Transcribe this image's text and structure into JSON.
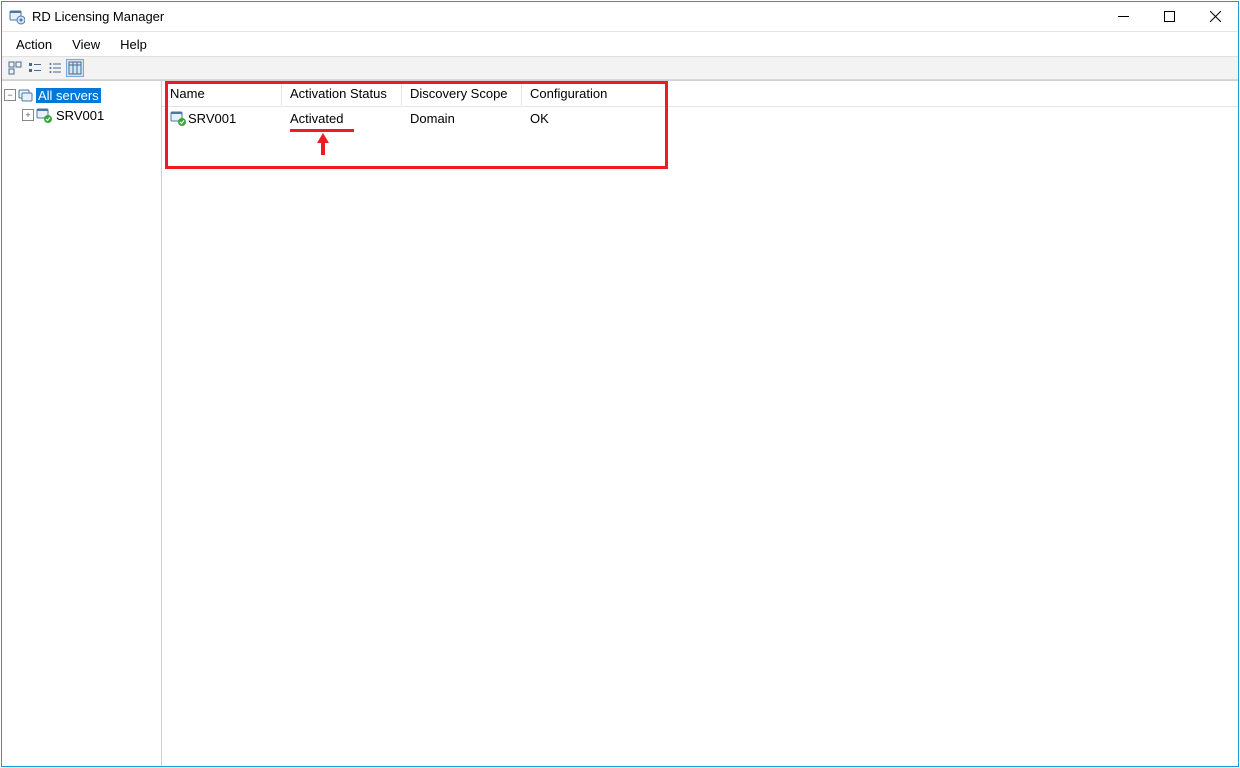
{
  "titlebar": {
    "title": "RD Licensing Manager"
  },
  "menubar": {
    "action": "Action",
    "view": "View",
    "help": "Help"
  },
  "tree": {
    "root": {
      "label": "All servers",
      "expanded": true
    },
    "server": {
      "label": "SRV001",
      "expandable": true
    }
  },
  "columns": {
    "name": "Name",
    "activation": "Activation Status",
    "discovery": "Discovery Scope",
    "config": "Configuration"
  },
  "rows": [
    {
      "name": "SRV001",
      "activation": "Activated",
      "discovery": "Domain",
      "config": "OK"
    }
  ]
}
